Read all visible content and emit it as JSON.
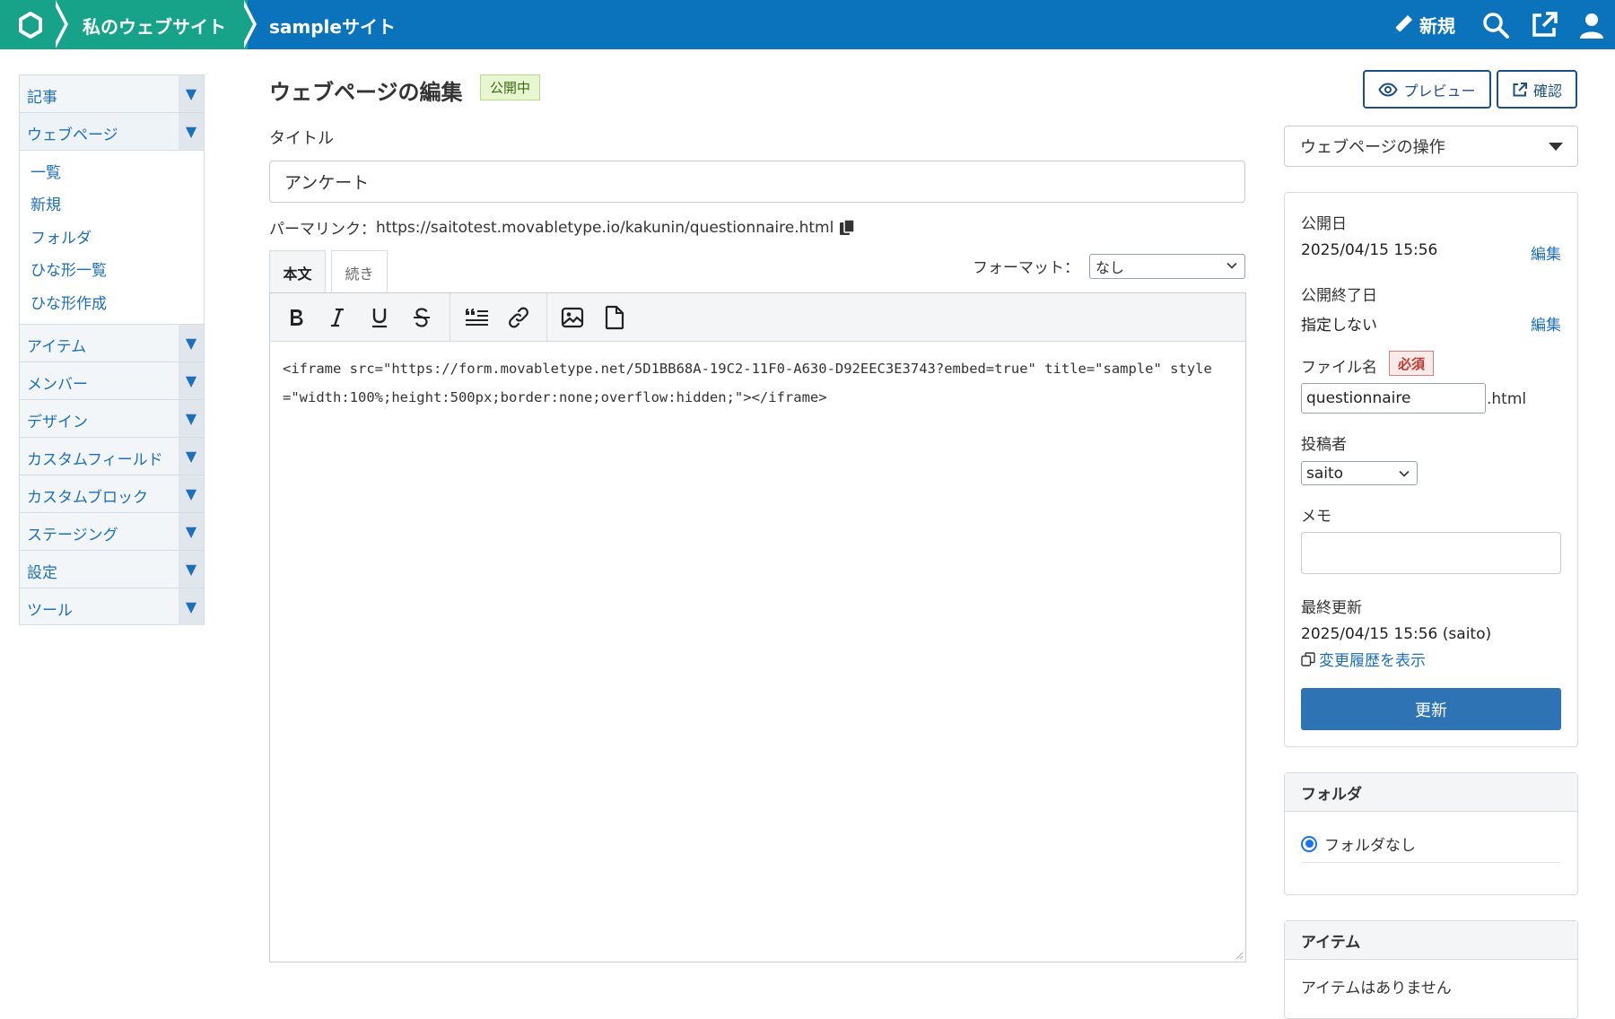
{
  "header": {
    "site_group": "私のウェブサイト",
    "site": "sampleサイト",
    "new_label": "新規",
    "colors": {
      "bar": "#0b73bb",
      "crumb": "#17a38a"
    },
    "icons": [
      "home-logo-icon",
      "pencil-icon",
      "search-icon",
      "external-link-icon",
      "user-icon"
    ]
  },
  "sidebar": {
    "items": [
      {
        "label": "記事"
      },
      {
        "label": "ウェブページ",
        "sub": [
          "一覧",
          "新規",
          "フォルダ",
          "ひな形一覧",
          "ひな形作成"
        ]
      },
      {
        "label": "アイテム"
      },
      {
        "label": "メンバー"
      },
      {
        "label": "デザイン"
      },
      {
        "label": "カスタムフィールド"
      },
      {
        "label": "カスタムブロック"
      },
      {
        "label": "ステージング"
      },
      {
        "label": "設定"
      },
      {
        "label": "ツール"
      }
    ],
    "caret": "▼"
  },
  "main": {
    "page_title": "ウェブページの編集",
    "status": "公開中",
    "title_label": "タイトル",
    "title_value": "アンケート",
    "permalink_label": "パーマリンク：",
    "permalink_url": "https://saitotest.movabletype.io/kakunin/questionnaire.html",
    "tabs": [
      {
        "label": "本文"
      },
      {
        "label": "続き"
      }
    ],
    "format_label": "フォーマット：",
    "format_value": "なし",
    "toolbar": [
      "bold-icon",
      "italic-icon",
      "underline-icon",
      "strikethrough-icon",
      "blockquote-icon",
      "link-icon",
      "image-icon",
      "file-icon"
    ],
    "editor_content": "<iframe src=\"https://form.movabletype.net/5D1BB68A-19C2-11F0-A630-D92EEC3E3743?embed=true\" title=\"sample\" style=\"width:100%;height:500px;border:none;overflow:hidden;\"></iframe>"
  },
  "right": {
    "preview_label": "プレビュー",
    "confirm_label": "確認",
    "actions_select": "ウェブページの操作",
    "publish": {
      "pub_date_label": "公開日",
      "pub_date": "2025/04/15 15:56",
      "edit": "編集",
      "end_date_label": "公開終了日",
      "end_date": "指定しない",
      "filename_label": "ファイル名",
      "required": "必須",
      "filename": "questionnaire",
      "filename_ext": ".html",
      "author_label": "投稿者",
      "author": "saito",
      "memo_label": "メモ",
      "last_updated_label": "最終更新",
      "last_updated": "2025/04/15 15:56 (saito)",
      "history_link": "変更履歴を表示",
      "update_button": "更新"
    },
    "folder": {
      "title": "フォルダ",
      "option": "フォルダなし"
    },
    "item": {
      "title": "アイテム",
      "empty": "アイテムはありません"
    }
  }
}
